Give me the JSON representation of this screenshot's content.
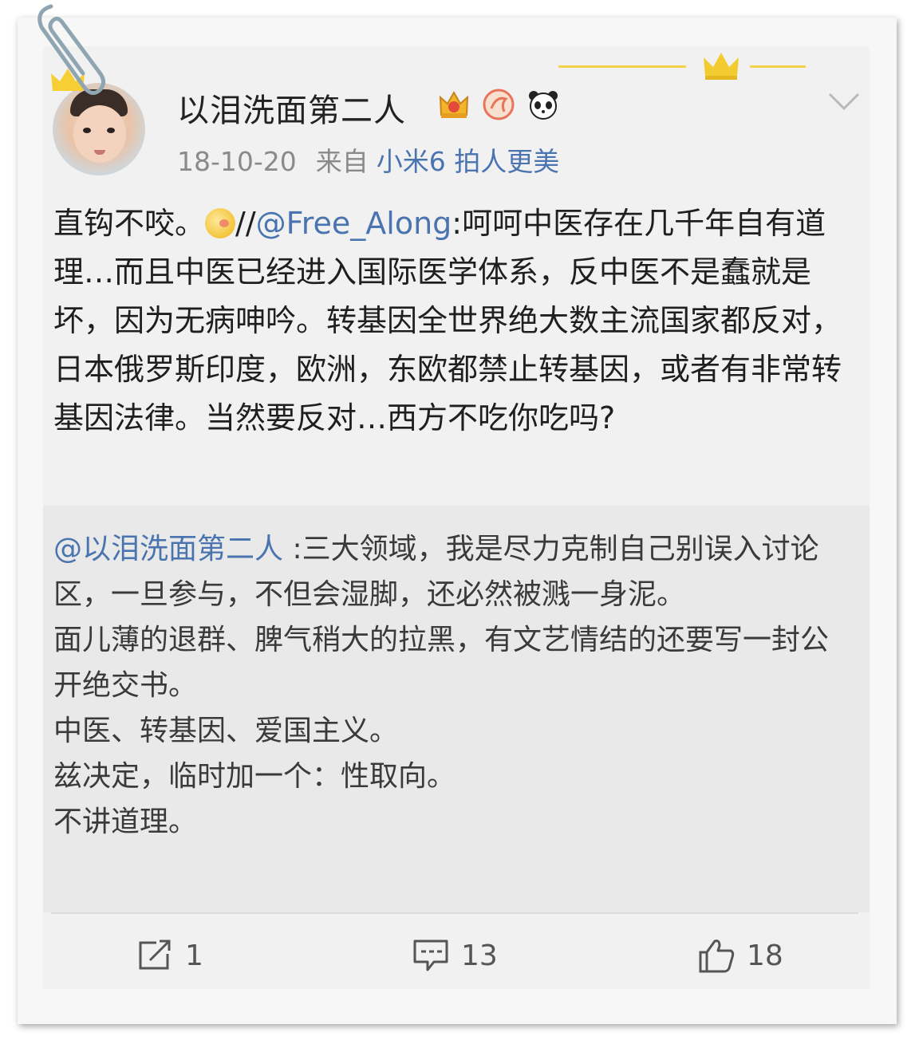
{
  "post": {
    "username": "以泪洗面第二人",
    "date": "18-10-20",
    "source_label": "来自",
    "device": "小米6 拍人更美",
    "body": {
      "part1": "直钩不咬。",
      "part2": "//",
      "mention": "@Free_Along",
      "part3": ":呵呵中医存在几千年自有道理…而且中医已经进入国际医学体系，反中医不是蠢就是坏，因为无病呻吟。转基因全世界绝大数主流国家都反对，日本俄罗斯印度，欧洲，东欧都禁止转基因，或者有非常转基因法律。当然要反对…西方不吃你吃吗?"
    },
    "quote": {
      "mention": "@以泪洗面第二人",
      "text": " :三大领域，我是尽力克制自己别误入讨论区，一旦参与，不但会湿脚，还必然被溅一身泥。\n面儿薄的退群、脾气稍大的拉黑，有文艺情结的还要写一封公开绝交书。\n中医、转基因、爱国主义。\n兹决定，临时加一个：性取向。\n不讲道理。"
    },
    "actions": {
      "repost_count": "1",
      "comment_count": "13",
      "like_count": "18"
    }
  },
  "colors": {
    "accent": "#4a74b0",
    "gold": "#f2d24a"
  },
  "icons": [
    "paperclip-icon",
    "crown-icon",
    "vip-crown-badge-icon",
    "zodiac-badge-icon",
    "panda-badge-icon",
    "chevron-down-icon",
    "emoji-icon",
    "repost-icon",
    "comment-icon",
    "like-icon"
  ]
}
